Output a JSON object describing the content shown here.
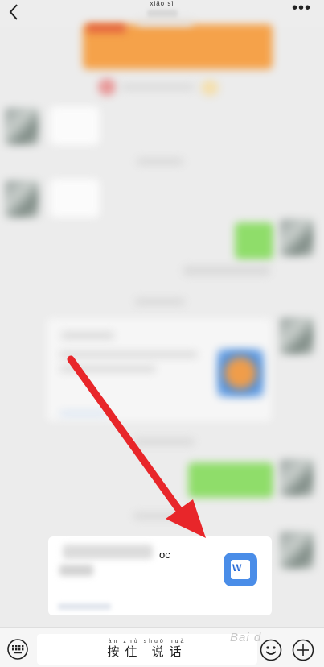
{
  "header": {
    "title_pinyin": "xiǎo sì",
    "more_glyph": "•••"
  },
  "file_message": {
    "extension_fragment": "oc",
    "icon_letter": "W"
  },
  "input_bar": {
    "talk_pinyin": "àn zhù shuō huà",
    "talk_label": "按住 说话"
  },
  "watermark": "Bai  d"
}
